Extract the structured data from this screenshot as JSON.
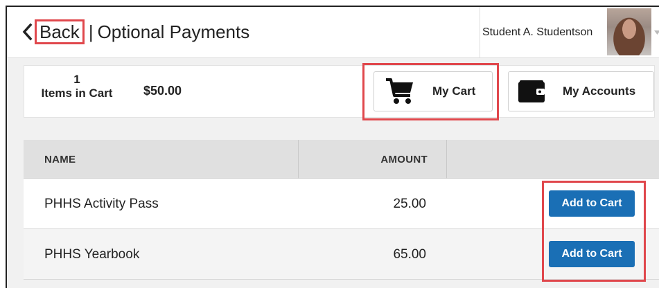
{
  "header": {
    "back_label": "Back",
    "separator": "|",
    "title": "Optional Payments",
    "user_name": "Student A. Studentson"
  },
  "cart_summary": {
    "count": "1",
    "count_label": "Items in Cart",
    "total": "$50.00",
    "my_cart_label": "My Cart",
    "my_accounts_label": "My Accounts"
  },
  "table": {
    "columns": [
      "NAME",
      "AMOUNT"
    ],
    "rows": [
      {
        "name": "PHHS Activity Pass",
        "amount": "25.00",
        "action": "Add to Cart"
      },
      {
        "name": "PHHS Yearbook",
        "amount": "65.00",
        "action": "Add to Cart"
      }
    ]
  },
  "colors": {
    "primary_button": "#1a6fb5",
    "highlight": "#e0474c",
    "header_bg": "#e0e0e0"
  },
  "icons": {
    "back": "chevron-left-icon",
    "cart": "shopping-cart-icon",
    "accounts": "wallet-icon",
    "user_menu": "caret-down-icon"
  }
}
